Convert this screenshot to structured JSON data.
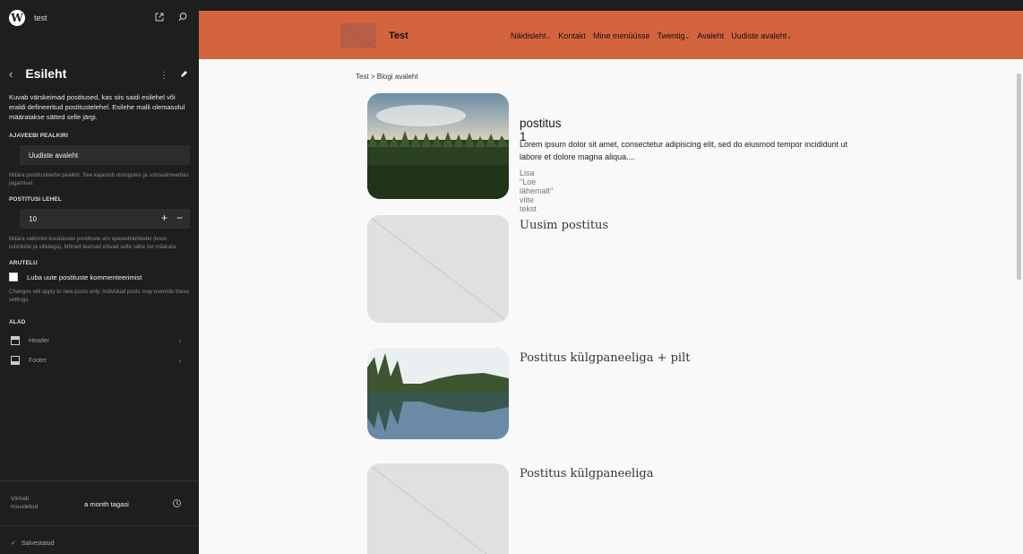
{
  "sidebar": {
    "site_name": "test",
    "wp_logo": "W",
    "title": "Esileht",
    "description": "Kuvab värskeimad postitused, kas siis saidi esilehel või eraldi defineeritud postitustelehel. Esilehe malli olemasolul määratakse sätted selle järgi.",
    "blog_title_label": "AJAVEEBI PEALKIRI",
    "blog_title_value": "Uudiste avaleht",
    "blog_title_help": "Määra postitustelehe pealkiri. See kajastub otsingutes ja sotsiaalmeedias jagamisel.",
    "posts_per_page_label": "POSTITUSI LEHEL",
    "posts_per_page_value": "10",
    "plus": "+",
    "minus": "−",
    "posts_per_page_help": "Määra vaikimisi kuvatavate postituste arv ajaveebilehtedel (koos rubriikide ja siltidega). Mõned teemad võivad selle sätte ise määrata.",
    "discussion_label": "ARUTELU",
    "discussion_checkbox_label": "Luba uute postituste kommenteerimist",
    "discussion_help": "Changes will apply to new posts only. Individual posts may override these settings.",
    "areas_label": "ALAD",
    "areas": [
      {
        "label": "Header"
      },
      {
        "label": "Footer"
      }
    ],
    "last_modified_label": "Viimati muudetud",
    "last_modified_value": "a month tagasi",
    "saved_label": "Salvestatud",
    "check_mark": "✓"
  },
  "canvas": {
    "site_title": "Test",
    "nav": [
      {
        "label": "Näidisleht",
        "chevron": "⌄"
      },
      {
        "label": "Kontakt",
        "chevron": ""
      },
      {
        "label": "Mine menüüsse",
        "chevron": ""
      },
      {
        "label": "Twentig",
        "chevron": "⌄"
      },
      {
        "label": "Avaleht",
        "chevron": ""
      },
      {
        "label": "Uudiste avaleht",
        "chevron": "⌄"
      }
    ],
    "breadcrumb": "Test > Blogi avaleht",
    "posts": [
      {
        "title": "postitus 1",
        "excerpt": "Lorem ipsum dolor sit amet, consectetur adipiscing elit, sed do eiusmod tempor incididunt ut labore et dolore magna aliqua....",
        "readmore": "Lisa \"Loe lähemalt\" viite tekst"
      },
      {
        "title": "Uusim postitus"
      },
      {
        "title": "Postitus külgpaneeliga + pilt"
      },
      {
        "title": "Postitus külgpaneeliga"
      }
    ]
  },
  "colors": {
    "sidebar_bg": "#1e1e1e",
    "header_orange": "#d4643e",
    "canvas_bg": "#f9f9f9"
  }
}
